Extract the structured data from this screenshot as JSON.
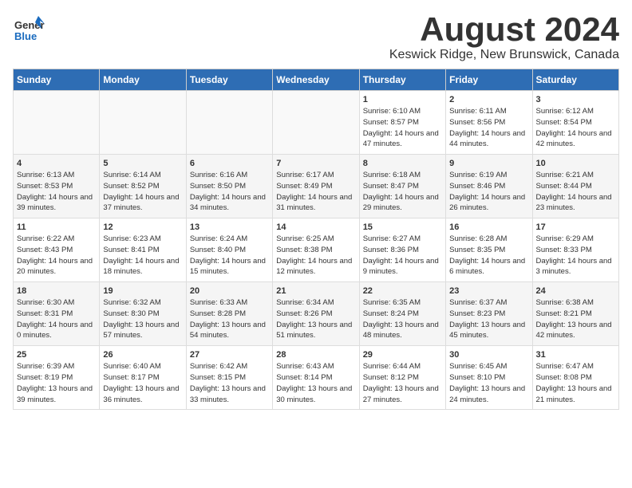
{
  "logo": {
    "line1": "General",
    "line2": "Blue"
  },
  "title": "August 2024",
  "subtitle": "Keswick Ridge, New Brunswick, Canada",
  "weekdays": [
    "Sunday",
    "Monday",
    "Tuesday",
    "Wednesday",
    "Thursday",
    "Friday",
    "Saturday"
  ],
  "weeks": [
    [
      {
        "day": "",
        "info": ""
      },
      {
        "day": "",
        "info": ""
      },
      {
        "day": "",
        "info": ""
      },
      {
        "day": "",
        "info": ""
      },
      {
        "day": "1",
        "info": "Sunrise: 6:10 AM\nSunset: 8:57 PM\nDaylight: 14 hours and 47 minutes."
      },
      {
        "day": "2",
        "info": "Sunrise: 6:11 AM\nSunset: 8:56 PM\nDaylight: 14 hours and 44 minutes."
      },
      {
        "day": "3",
        "info": "Sunrise: 6:12 AM\nSunset: 8:54 PM\nDaylight: 14 hours and 42 minutes."
      }
    ],
    [
      {
        "day": "4",
        "info": "Sunrise: 6:13 AM\nSunset: 8:53 PM\nDaylight: 14 hours and 39 minutes."
      },
      {
        "day": "5",
        "info": "Sunrise: 6:14 AM\nSunset: 8:52 PM\nDaylight: 14 hours and 37 minutes."
      },
      {
        "day": "6",
        "info": "Sunrise: 6:16 AM\nSunset: 8:50 PM\nDaylight: 14 hours and 34 minutes."
      },
      {
        "day": "7",
        "info": "Sunrise: 6:17 AM\nSunset: 8:49 PM\nDaylight: 14 hours and 31 minutes."
      },
      {
        "day": "8",
        "info": "Sunrise: 6:18 AM\nSunset: 8:47 PM\nDaylight: 14 hours and 29 minutes."
      },
      {
        "day": "9",
        "info": "Sunrise: 6:19 AM\nSunset: 8:46 PM\nDaylight: 14 hours and 26 minutes."
      },
      {
        "day": "10",
        "info": "Sunrise: 6:21 AM\nSunset: 8:44 PM\nDaylight: 14 hours and 23 minutes."
      }
    ],
    [
      {
        "day": "11",
        "info": "Sunrise: 6:22 AM\nSunset: 8:43 PM\nDaylight: 14 hours and 20 minutes."
      },
      {
        "day": "12",
        "info": "Sunrise: 6:23 AM\nSunset: 8:41 PM\nDaylight: 14 hours and 18 minutes."
      },
      {
        "day": "13",
        "info": "Sunrise: 6:24 AM\nSunset: 8:40 PM\nDaylight: 14 hours and 15 minutes."
      },
      {
        "day": "14",
        "info": "Sunrise: 6:25 AM\nSunset: 8:38 PM\nDaylight: 14 hours and 12 minutes."
      },
      {
        "day": "15",
        "info": "Sunrise: 6:27 AM\nSunset: 8:36 PM\nDaylight: 14 hours and 9 minutes."
      },
      {
        "day": "16",
        "info": "Sunrise: 6:28 AM\nSunset: 8:35 PM\nDaylight: 14 hours and 6 minutes."
      },
      {
        "day": "17",
        "info": "Sunrise: 6:29 AM\nSunset: 8:33 PM\nDaylight: 14 hours and 3 minutes."
      }
    ],
    [
      {
        "day": "18",
        "info": "Sunrise: 6:30 AM\nSunset: 8:31 PM\nDaylight: 14 hours and 0 minutes."
      },
      {
        "day": "19",
        "info": "Sunrise: 6:32 AM\nSunset: 8:30 PM\nDaylight: 13 hours and 57 minutes."
      },
      {
        "day": "20",
        "info": "Sunrise: 6:33 AM\nSunset: 8:28 PM\nDaylight: 13 hours and 54 minutes."
      },
      {
        "day": "21",
        "info": "Sunrise: 6:34 AM\nSunset: 8:26 PM\nDaylight: 13 hours and 51 minutes."
      },
      {
        "day": "22",
        "info": "Sunrise: 6:35 AM\nSunset: 8:24 PM\nDaylight: 13 hours and 48 minutes."
      },
      {
        "day": "23",
        "info": "Sunrise: 6:37 AM\nSunset: 8:23 PM\nDaylight: 13 hours and 45 minutes."
      },
      {
        "day": "24",
        "info": "Sunrise: 6:38 AM\nSunset: 8:21 PM\nDaylight: 13 hours and 42 minutes."
      }
    ],
    [
      {
        "day": "25",
        "info": "Sunrise: 6:39 AM\nSunset: 8:19 PM\nDaylight: 13 hours and 39 minutes."
      },
      {
        "day": "26",
        "info": "Sunrise: 6:40 AM\nSunset: 8:17 PM\nDaylight: 13 hours and 36 minutes."
      },
      {
        "day": "27",
        "info": "Sunrise: 6:42 AM\nSunset: 8:15 PM\nDaylight: 13 hours and 33 minutes."
      },
      {
        "day": "28",
        "info": "Sunrise: 6:43 AM\nSunset: 8:14 PM\nDaylight: 13 hours and 30 minutes."
      },
      {
        "day": "29",
        "info": "Sunrise: 6:44 AM\nSunset: 8:12 PM\nDaylight: 13 hours and 27 minutes."
      },
      {
        "day": "30",
        "info": "Sunrise: 6:45 AM\nSunset: 8:10 PM\nDaylight: 13 hours and 24 minutes."
      },
      {
        "day": "31",
        "info": "Sunrise: 6:47 AM\nSunset: 8:08 PM\nDaylight: 13 hours and 21 minutes."
      }
    ]
  ]
}
